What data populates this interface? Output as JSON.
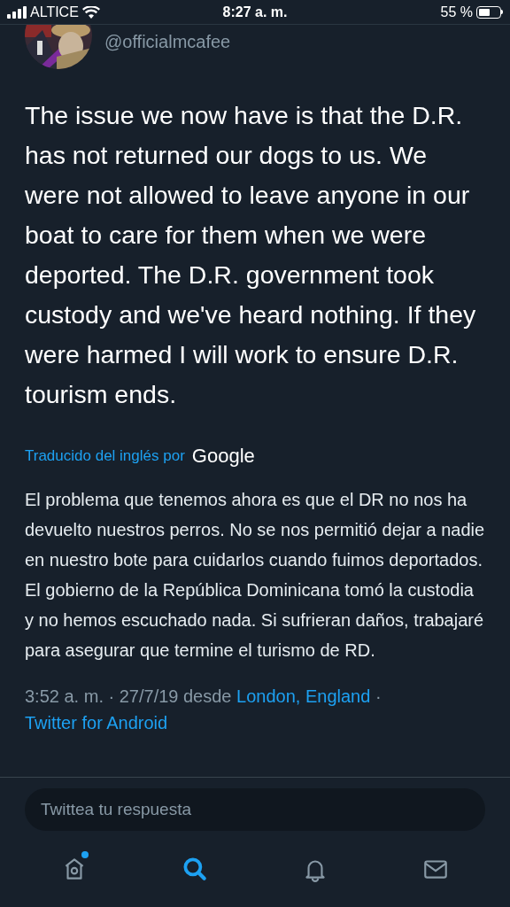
{
  "status_bar": {
    "carrier": "ALTICE",
    "time": "8:27 a. m.",
    "battery": "55 %"
  },
  "tweet": {
    "handle": "@officialmcafee",
    "text": "The issue we now have is that the D.R. has not returned our dogs to us. We were not allowed to leave anyone in our boat to care for them when we were deported. The D.R. government took custody and we've heard nothing. If they were harmed I will work to ensure D.R. tourism ends.",
    "translated_by": "Traducido del inglés por",
    "translator": "Google",
    "translation": "El problema que tenemos ahora es que el DR no nos ha devuelto nuestros perros. No se nos permitió dejar a nadie en nuestro bote para cuidarlos cuando fuimos deportados. El gobierno de la República Dominicana tomó la custodia y no hemos escuchado nada. Si sufrieran daños, trabajaré para asegurar que termine el turismo de RD.",
    "timestamp": "3:52 a. m. · 27/7/19 desde",
    "location": "London, England",
    "separator": "·",
    "source": "Twitter for Android"
  },
  "reply": {
    "placeholder": "Twittea tu respuesta"
  },
  "tab_bar": [
    {
      "kind": "home",
      "selected": false,
      "badge": true
    },
    {
      "kind": "search",
      "selected": true,
      "badge": false
    },
    {
      "kind": "notifications",
      "selected": false,
      "badge": false
    },
    {
      "kind": "messages",
      "selected": false,
      "badge": false
    }
  ]
}
